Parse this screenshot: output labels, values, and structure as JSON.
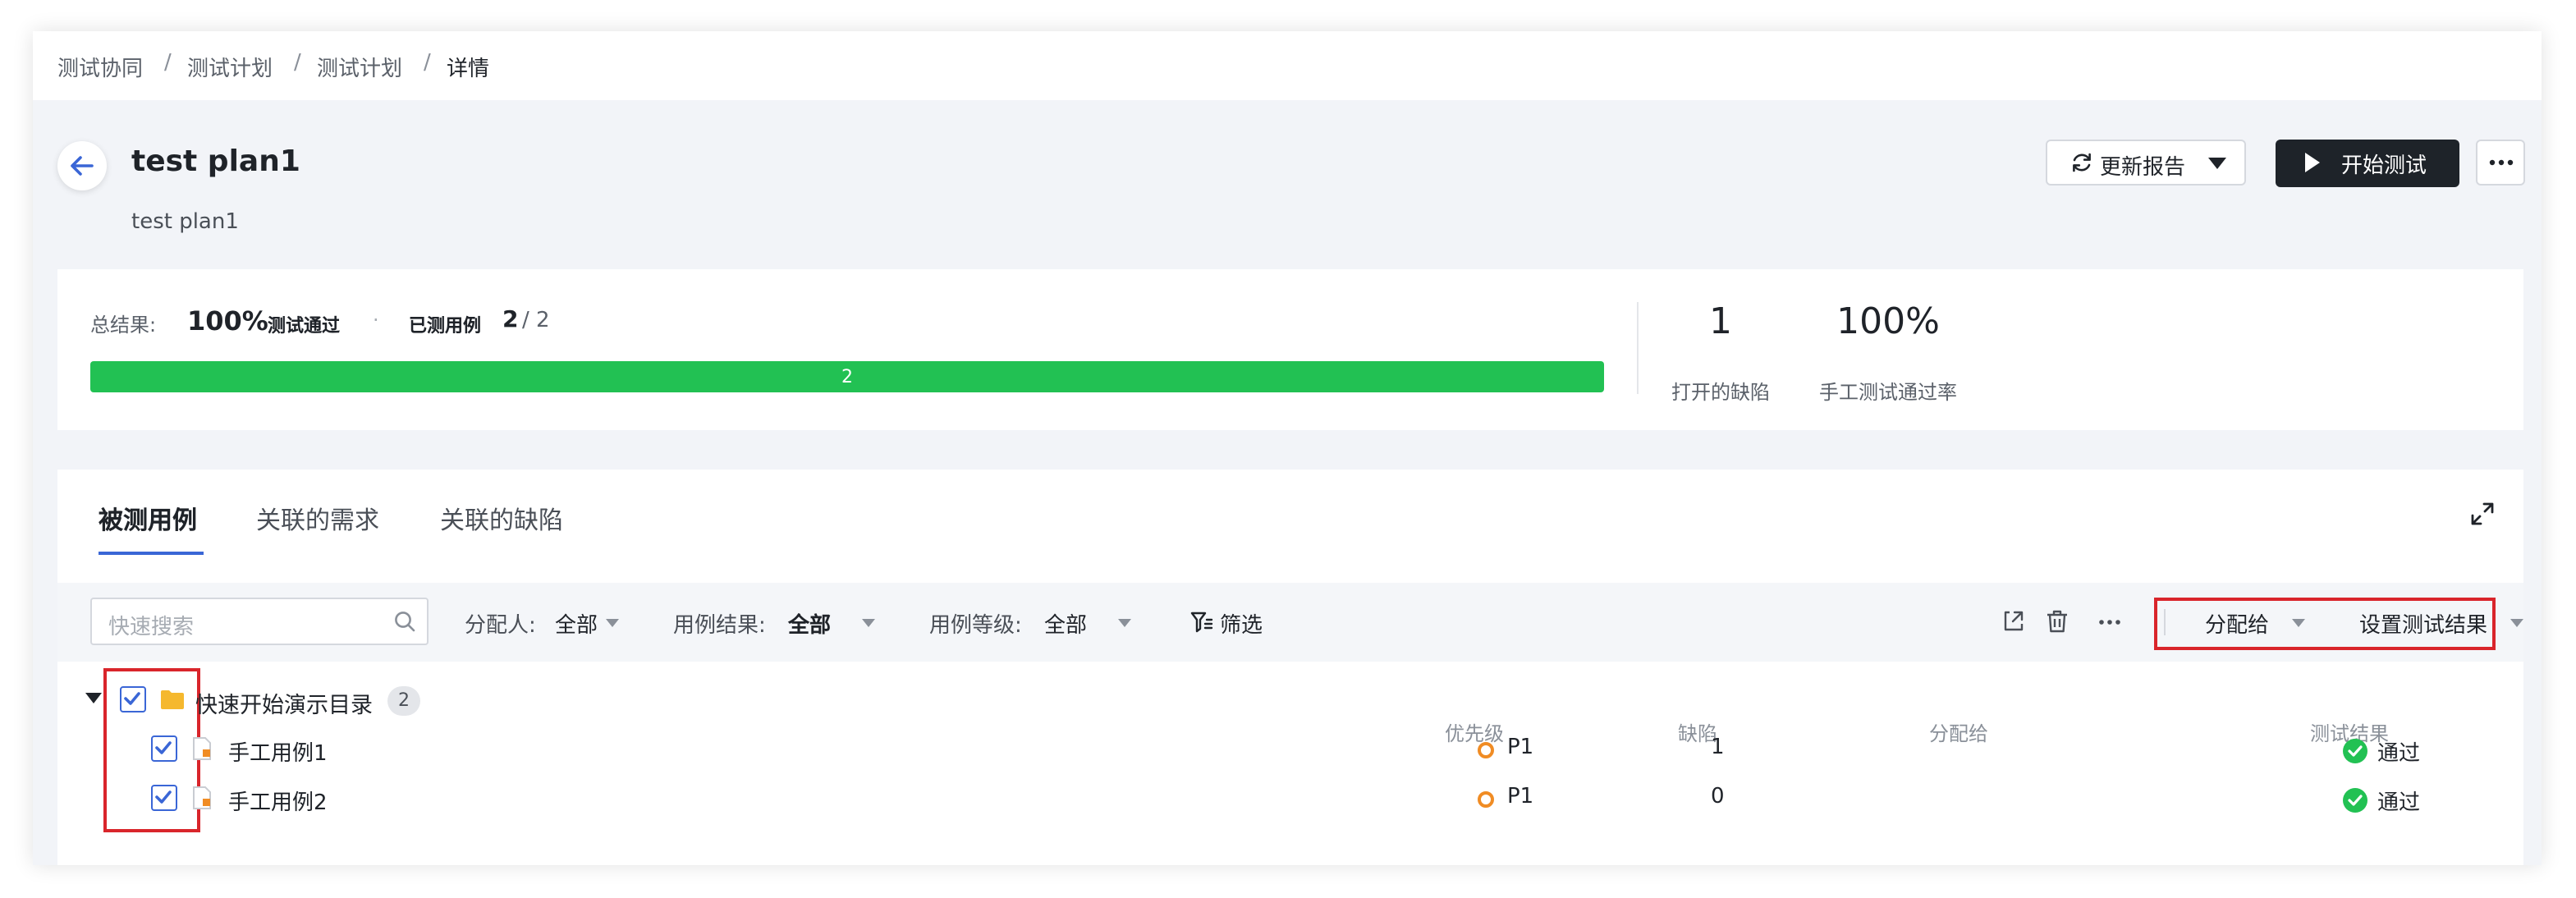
{
  "breadcrumb": [
    "测试协同",
    "测试计划",
    "测试计划",
    "详情"
  ],
  "breadcrumb_sep": "/",
  "plan": {
    "title": "test plan1",
    "subtitle": "test plan1"
  },
  "actions": {
    "report_label": "更新报告",
    "start_label": "开始测试"
  },
  "summary": {
    "total_label": "总结果:",
    "pass_percent": "100%",
    "pass_label": "测试通过",
    "dot": "·",
    "tested_label": "已测用例",
    "tested_count": "2",
    "tested_total": "/ 2",
    "progress_value": "2",
    "progress_fraction": 1.0,
    "open_bugs": "1",
    "open_bugs_label": "打开的缺陷",
    "manual_pass_rate": "100%",
    "manual_pass_rate_label": "手工测试通过率"
  },
  "tabs": [
    {
      "label": "被测用例",
      "active": true
    },
    {
      "label": "关联的需求",
      "active": false
    },
    {
      "label": "关联的缺陷",
      "active": false
    }
  ],
  "toolbar": {
    "search_placeholder": "快速搜索",
    "assignee_label": "分配人:",
    "assignee_value": "全部",
    "result_label": "用例结果:",
    "result_value": "全部",
    "level_label": "用例等级:",
    "level_value": "全部",
    "filter_label": "筛选",
    "assign_to": "分配给",
    "set_result": "设置测试结果"
  },
  "columns": {
    "priority": "优先级",
    "defects": "缺陷",
    "assignee": "分配给",
    "result": "测试结果"
  },
  "folder": {
    "name": "快速开始演示目录",
    "count": "2"
  },
  "rows": [
    {
      "name": "手工用例1",
      "priority": "P1",
      "defects": "1",
      "result": "通过"
    },
    {
      "name": "手工用例2",
      "priority": "P1",
      "defects": "0",
      "result": "通过"
    }
  ],
  "colors": {
    "accent": "#3a66d6",
    "progress": "#22c153",
    "priority": "#f08c24",
    "highlight": "#d9252b",
    "dark_button": "#1e2329"
  }
}
